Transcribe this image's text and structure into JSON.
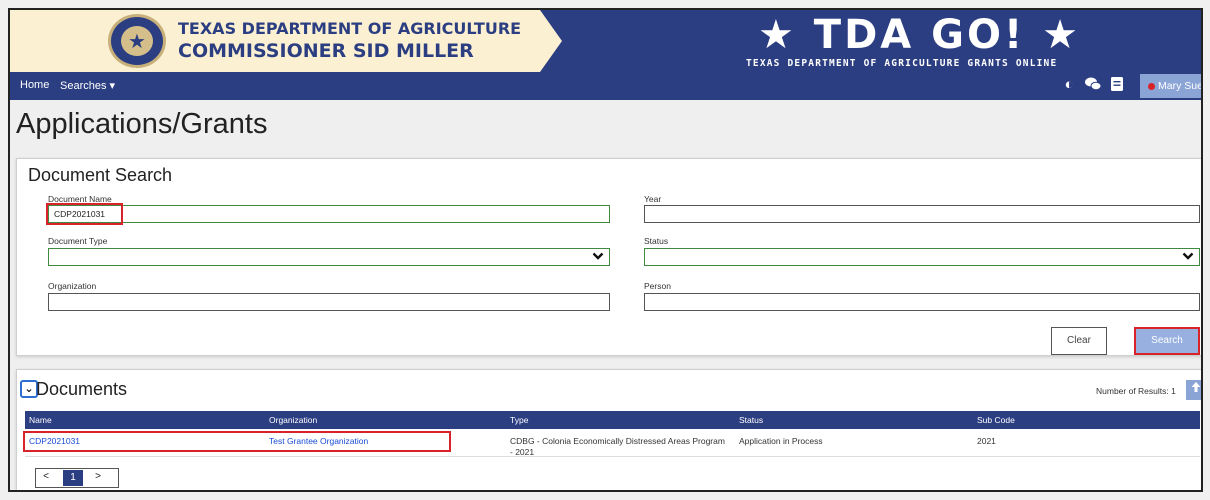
{
  "banner": {
    "agency_line1": "TEXAS DEPARTMENT OF AGRICULTURE",
    "agency_line2": "COMMISSIONER SID MILLER",
    "logo_text": "★ TDA GO! ★",
    "logo_subtitle": "TEXAS DEPARTMENT OF AGRICULTURE GRANTS ONLINE"
  },
  "nav": {
    "home": "Home",
    "searches": "Searches ▾",
    "user": "Mary Sue ▾"
  },
  "page": {
    "title": "Applications/Grants"
  },
  "search": {
    "title": "Document Search",
    "document_name_label": "Document Name",
    "document_name_value": "CDP2021031",
    "year_label": "Year",
    "year_value": "",
    "document_type_label": "Document Type",
    "document_type_value": "",
    "status_label": "Status",
    "status_value": "",
    "organization_label": "Organization",
    "organization_value": "",
    "person_label": "Person",
    "person_value": "",
    "clear_label": "Clear",
    "search_label": "Search"
  },
  "documents": {
    "title": "Documents",
    "result_count": "Number of Results: 1",
    "columns": [
      "Name",
      "Organization",
      "Type",
      "Status",
      "Sub Code"
    ],
    "rows": [
      {
        "name": "CDP2021031",
        "organization": "Test Grantee Organization",
        "type": "CDBG - Colonia Economically Distressed Areas Program - 2021",
        "status": "Application in Process",
        "sub_code": "2021"
      }
    ],
    "pager": {
      "prev": "<",
      "current": "1",
      "next": ">"
    }
  },
  "colors": {
    "brand_navy": "#2c3e82",
    "banner_cream": "#fbf1d2",
    "highlight_red": "#d8232a",
    "accent_blue": "#8aa4d6"
  },
  "icons": [
    "seal-icon",
    "contrast-icon",
    "chat-icon",
    "notes-icon",
    "chevron-down-icon",
    "export-icon"
  ]
}
